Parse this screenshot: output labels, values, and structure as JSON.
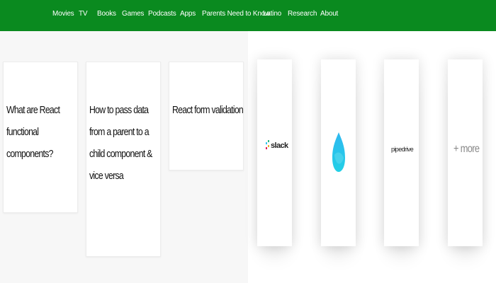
{
  "nav": {
    "items": [
      {
        "label": "Movies"
      },
      {
        "label": "TV"
      },
      {
        "label": "Books"
      },
      {
        "label": "Games"
      },
      {
        "label": "Podcasts"
      },
      {
        "label": "Apps"
      },
      {
        "label": "Parents Need to Know"
      },
      {
        "label": "Latino"
      },
      {
        "label": "Research"
      },
      {
        "label": "About"
      }
    ],
    "bg_color": "#0a8a1f"
  },
  "articles": [
    {
      "title": "What are React functional components?"
    },
    {
      "title": "How to pass data from a parent to a child component & vice versa"
    },
    {
      "title": "React form validation"
    }
  ],
  "integrations": {
    "slack": {
      "label": "slack",
      "icon": "slack-icon"
    },
    "app2": {
      "icon": "drop-shape-logo-icon"
    },
    "pipedrive": {
      "label": "pipedrive",
      "icon": "pipedrive-wordmark"
    },
    "more": {
      "label": "+ more"
    }
  }
}
